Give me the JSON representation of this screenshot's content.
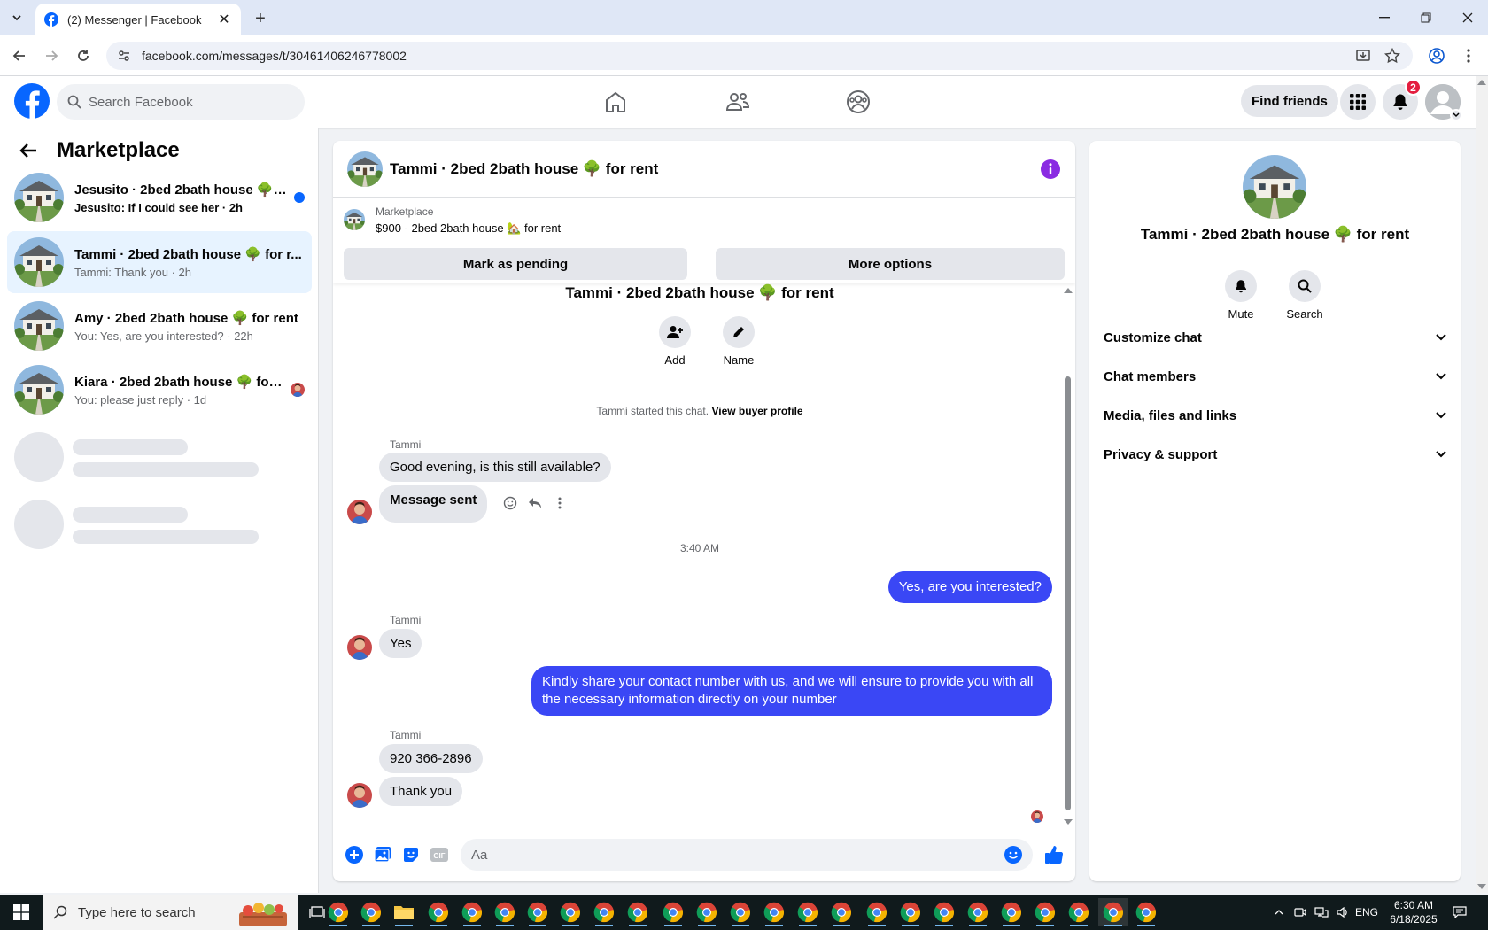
{
  "browser": {
    "tab_title": "(2) Messenger | Facebook",
    "url": "facebook.com/messages/t/30461406246778002"
  },
  "header": {
    "search_placeholder": "Search Facebook",
    "find_friends": "Find friends",
    "notification_count": "2"
  },
  "sidebar": {
    "title": "Marketplace",
    "conversations": [
      {
        "name": "Jesusito · 2bed 2bath house 🌳 f...",
        "preview": "Jesusito: If I could see her · 2h",
        "unread": true
      },
      {
        "name": "Tammi · 2bed 2bath house 🌳 for r...",
        "preview": "Tammi: Thank you · 2h",
        "active": true
      },
      {
        "name": "Amy · 2bed 2bath house 🌳 for rent",
        "preview": "You: Yes, are you interested? · 22h"
      },
      {
        "name": "Kiara · 2bed 2bath house 🌳 for ...",
        "preview": "You: please just reply · 1d"
      }
    ]
  },
  "chat": {
    "title": "Tammi · 2bed 2bath house 🌳 for rent",
    "listing_category": "Marketplace",
    "listing_title": "$900 - 2bed 2bath house 🏡 for rent",
    "mark_pending": "Mark as pending",
    "more_options": "More options",
    "intro_title": "Tammi · 2bed 2bath house 🌳 for rent",
    "add_label": "Add",
    "name_label": "Name",
    "started_text": "Tammi started this chat.",
    "view_buyer": "View buyer profile",
    "sender_name": "Tammi",
    "messages": {
      "m1": "Good evening, is this still available?",
      "m2": "Message sent",
      "time": "3:40 AM",
      "m3": "Yes, are you interested?",
      "m4": "Yes",
      "m5": "Kindly share your contact number with us, and we will ensure to provide you with all the necessary information directly on your number",
      "m6": "920 366-2896",
      "m7": "Thank you"
    },
    "composer_placeholder": "Aa"
  },
  "details": {
    "name": "Tammi · 2bed 2bath house 🌳 for rent",
    "mute": "Mute",
    "search": "Search",
    "sections": [
      "Customize chat",
      "Chat members",
      "Media, files and links",
      "Privacy & support"
    ]
  },
  "taskbar": {
    "search_placeholder": "Type here to search",
    "lang": "ENG",
    "time": "6:30 AM",
    "date": "6/18/2025"
  },
  "colors": {
    "fb_blue": "#0866ff",
    "outgoing_bubble": "#3a47f5",
    "accent_purple": "#8a2be2"
  }
}
